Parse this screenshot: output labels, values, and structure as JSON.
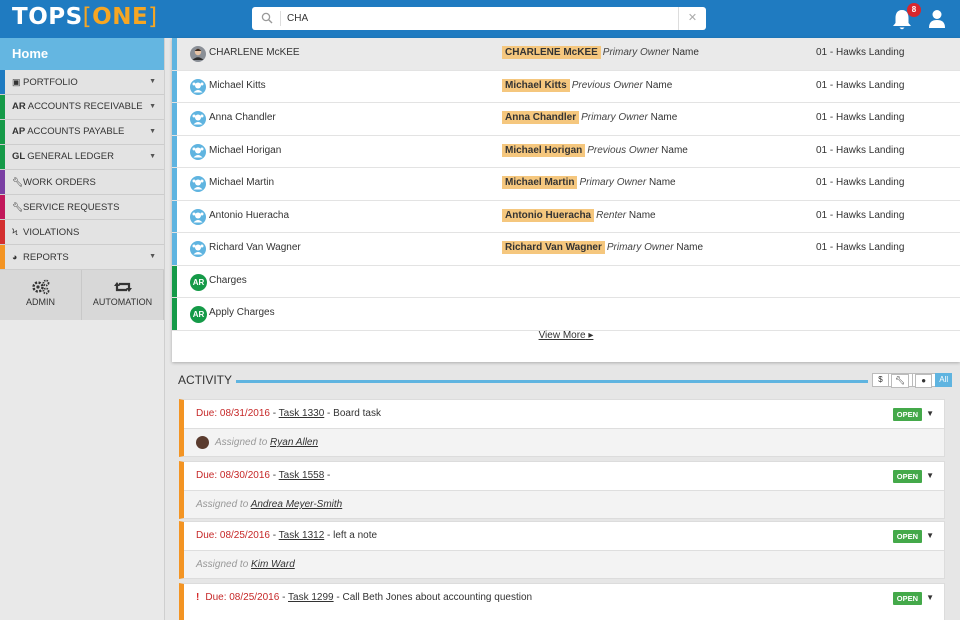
{
  "app": {
    "logo_main": "TOPS",
    "logo_bracket_open": "[",
    "logo_product": "ONE",
    "logo_bracket_close": "]"
  },
  "search": {
    "value": "CHA",
    "clear_icon": "close-icon"
  },
  "notifications": {
    "count": "8"
  },
  "sidebar": {
    "home_label": "Home",
    "items": [
      {
        "icon": "building-icon",
        "abbr": "",
        "label": "PORTFOLIO",
        "color": "#1f7bc1",
        "has_caret": true
      },
      {
        "icon": "",
        "abbr": "AR",
        "label": "ACCOUNTS RECEIVABLE",
        "color": "#159a48",
        "has_caret": true
      },
      {
        "icon": "",
        "abbr": "AP",
        "label": "ACCOUNTS PAYABLE",
        "color": "#159a48",
        "has_caret": true
      },
      {
        "icon": "",
        "abbr": "GL",
        "label": "GENERAL LEDGER",
        "color": "#159a48",
        "has_caret": true
      },
      {
        "icon": "wrench-icon",
        "abbr": "",
        "label": "WORK ORDERS",
        "color": "#7a3fa3",
        "has_caret": false
      },
      {
        "icon": "wrench-icon",
        "abbr": "",
        "label": "SERVICE REQUESTS",
        "color": "#c2185b",
        "has_caret": false
      },
      {
        "icon": "bolt-icon",
        "abbr": "",
        "label": "VIOLATIONS",
        "color": "#d32f2f",
        "has_caret": false
      },
      {
        "icon": "pie-icon",
        "abbr": "",
        "label": "REPORTS",
        "color": "#f39423",
        "has_caret": true
      }
    ],
    "tiles": [
      {
        "icon": "gears-icon",
        "label": "ADMIN"
      },
      {
        "icon": "retweet-icon",
        "label": "AUTOMATION"
      }
    ]
  },
  "results": {
    "rows": [
      {
        "name": "CHARLENE McKEE",
        "match": "CHARLENE McKEE",
        "role": "Primary Owner",
        "field": "Name",
        "association": "01 - Hawks Landing",
        "avatar": "photo"
      },
      {
        "name": "Michael Kitts",
        "match": "Michael Kitts",
        "role": "Previous Owner",
        "field": "Name",
        "association": "01 - Hawks Landing",
        "avatar": "person"
      },
      {
        "name": "Anna Chandler",
        "match": "Anna Chandler",
        "role": "Primary Owner",
        "field": "Name",
        "association": "01 - Hawks Landing",
        "avatar": "person"
      },
      {
        "name": "Michael Horigan",
        "match": "Michael Horigan",
        "role": "Previous Owner",
        "field": "Name",
        "association": "01 - Hawks Landing",
        "avatar": "person"
      },
      {
        "name": "Michael Martin",
        "match": "Michael Martin",
        "role": "Primary Owner",
        "field": "Name",
        "association": "01 - Hawks Landing",
        "avatar": "person"
      },
      {
        "name": "Antonio Hueracha",
        "match": "Antonio Hueracha",
        "role": "Renter",
        "field": "Name",
        "association": "01 - Hawks Landing",
        "avatar": "person"
      },
      {
        "name": "Richard Van Wagner",
        "match": "Richard Van Wagner",
        "role": "Primary Owner",
        "field": "Name",
        "association": "01 - Hawks Landing",
        "avatar": "person"
      }
    ],
    "ar_items": [
      {
        "badge": "AR",
        "label": "Charges"
      },
      {
        "badge": "AR",
        "label": "Apply Charges"
      }
    ],
    "view_more": "View More",
    "colors": {
      "people": "#5fb4e0",
      "ar": "#159a48",
      "highlight": "#f5c77e"
    }
  },
  "activity": {
    "title": "ACTIVITY",
    "filters": [
      "$",
      "wrench-icon",
      "comment-icon",
      "All"
    ],
    "active_filter": "All",
    "tasks": [
      {
        "due": "Due: 08/31/2016",
        "sep": " - ",
        "task": "Task 1330",
        "desc": " - Board task",
        "status": "OPEN",
        "assigned_prefix": "Assigned to",
        "assignee": "Ryan Allen",
        "urgent": false,
        "has_avatar": true
      },
      {
        "due": "Due: 08/30/2016",
        "sep": " - ",
        "task": "Task 1558",
        "desc": " -",
        "status": "OPEN",
        "assigned_prefix": "Assigned to",
        "assignee": "Andrea Meyer-Smith",
        "urgent": false,
        "has_avatar": false
      },
      {
        "due": "Due: 08/25/2016",
        "sep": " - ",
        "task": "Task 1312",
        "desc": " - left a note",
        "status": "OPEN",
        "assigned_prefix": "Assigned to",
        "assignee": "Kim Ward",
        "urgent": false,
        "has_avatar": false
      },
      {
        "due": "Due: 08/25/2016",
        "sep": " - ",
        "task": "Task 1299",
        "desc": " - Call Beth Jones about accounting question",
        "status": "OPEN",
        "urgent": true,
        "urgent_mark": "!"
      }
    ]
  }
}
